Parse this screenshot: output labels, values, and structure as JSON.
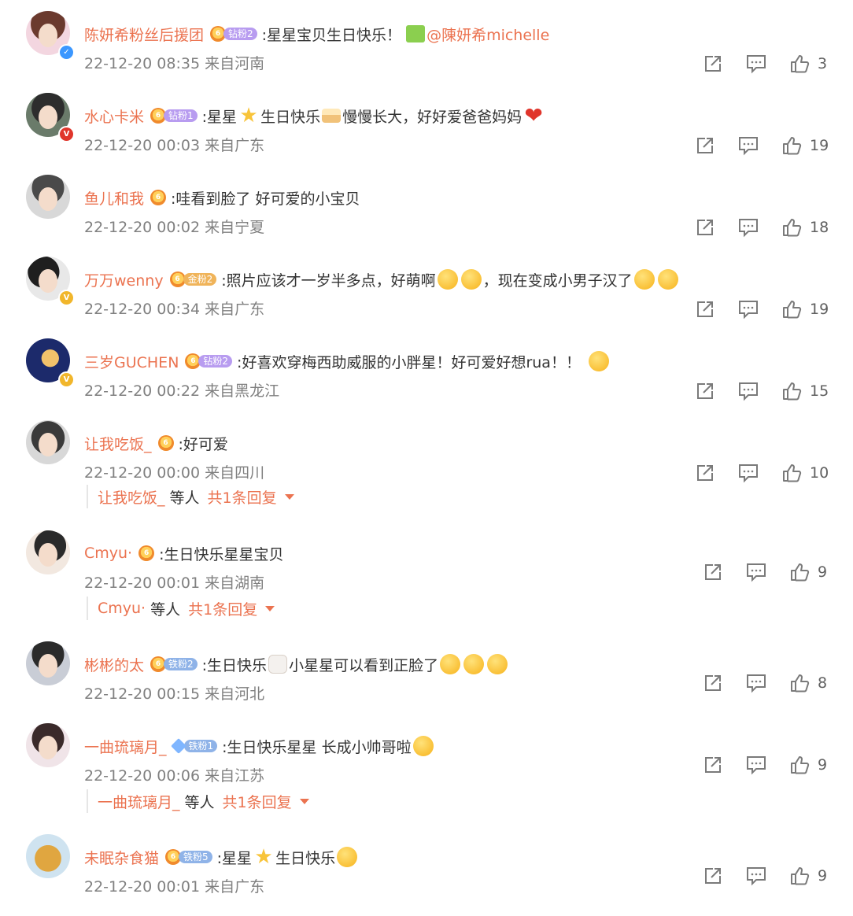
{
  "comments": [
    {
      "username": "陈妍希粉丝后援团",
      "badge": "钻粉2",
      "badge_color": "#b89cf0",
      "text": ":星星宝贝生日快乐！",
      "mention": "@陳妍希michelle",
      "time": "22-12-20 08:35",
      "location": "来自河南",
      "likes": "3",
      "verified": "blue",
      "avatar_colors": [
        "#f3d6e0",
        "#6b3a2e"
      ]
    },
    {
      "username": "水心卡米",
      "badge": "钻粉1",
      "badge_color": "#b89cf0",
      "text_a": ":星星",
      "text_b": "生日快乐",
      "text_c": "慢慢长大，好好爱爸爸妈妈",
      "time": "22-12-20 00:03",
      "location": "来自广东",
      "likes": "19",
      "verified": "red",
      "avatar_colors": [
        "#6a7b6a",
        "#2d2d2d"
      ]
    },
    {
      "username": "鱼儿和我",
      "text": ":哇看到脸了 好可爱的小宝贝",
      "time": "22-12-20 00:02",
      "location": "来自宁夏",
      "likes": "18",
      "avatar_colors": [
        "#d8d8d8",
        "#4a4a4a"
      ]
    },
    {
      "username": "万万wenny",
      "badge": "金粉2",
      "badge_color": "#f0b45a",
      "text_a": ":照片应该才一岁半多点，好萌啊",
      "text_b": "，现在变成小男子汉了",
      "time": "22-12-20 00:34",
      "location": "来自广东",
      "likes": "19",
      "verified": "yellow",
      "avatar_colors": [
        "#e8e8e8",
        "#1f1f1f"
      ]
    },
    {
      "username": "三岁GUCHEN",
      "badge": "钻粉2",
      "badge_color": "#b89cf0",
      "text": ":好喜欢穿梅西助威服的小胖星！好可爱好想rua！！",
      "time": "22-12-20 00:22",
      "location": "来自黑龙江",
      "likes": "15",
      "verified": "yellow",
      "avatar_colors": [
        "#1c2a6b",
        "#f2c26b"
      ]
    },
    {
      "username": "让我吃饭_",
      "text": ":好可爱",
      "time": "22-12-20 00:00",
      "location": "来自四川",
      "likes": "10",
      "avatar_colors": [
        "#d8d8d8",
        "#3a3a3a"
      ],
      "reply": {
        "name": "让我吃饭_",
        "mid": "等人",
        "link": "共1条回复"
      }
    },
    {
      "username": "Cmyu·",
      "text": ":生日快乐星星宝贝",
      "time": "22-12-20 00:01",
      "location": "来自湖南",
      "likes": "9",
      "avatar_colors": [
        "#f2e8e0",
        "#2a2a2a"
      ],
      "reply": {
        "name": "Cmyu·",
        "mid": "等人",
        "link": "共1条回复"
      }
    },
    {
      "username": "彬彬的太",
      "badge": "铁粉2",
      "badge_color": "#8fb3e8",
      "text_a": ":生日快乐",
      "text_b": "小星星可以看到正脸了",
      "time": "22-12-20 00:15",
      "location": "来自河北",
      "likes": "8",
      "avatar_colors": [
        "#c9cdd6",
        "#2b2b2b"
      ]
    },
    {
      "username": "一曲琉璃月_",
      "badge": "铁粉1",
      "badge_color": "#8fb3e8",
      "text": ":生日快乐星星 长成小帅哥啦",
      "time": "22-12-20 00:06",
      "location": "来自江苏",
      "likes": "9",
      "avatar_colors": [
        "#f0e4e8",
        "#3a2a2a"
      ],
      "reply": {
        "name": "一曲琉璃月_",
        "mid": "等人",
        "link": "共1条回复"
      }
    },
    {
      "username": "未眠杂食猫",
      "badge": "铁粉5",
      "badge_color": "#8fb3e8",
      "text_a": ":星星",
      "text_b": "生日快乐",
      "time": "22-12-20 00:01",
      "location": "来自广东",
      "likes": "9",
      "avatar_colors": [
        "#cfe3f0",
        "#e0a640"
      ]
    }
  ],
  "colors": {
    "username": "#eb7350",
    "meta": "#808080",
    "icon": "#7a7a7a"
  }
}
